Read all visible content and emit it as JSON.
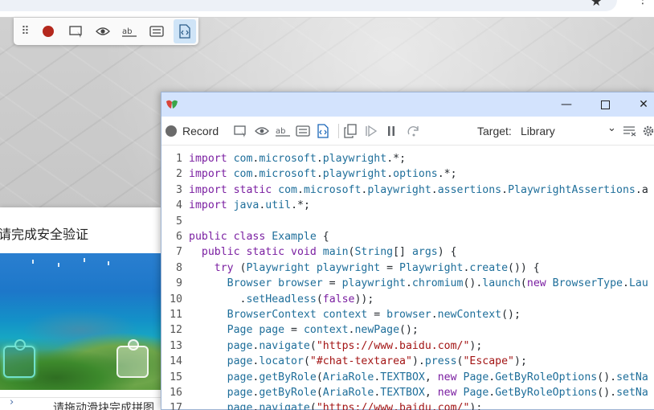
{
  "browser": {
    "star_icon": "star-icon",
    "menu_icon": "kebab-menu-icon"
  },
  "recorder_toolbar": {
    "items": [
      "drag-grip-icon",
      "record-icon",
      "pick-locator-icon",
      "assert-visibility-icon",
      "assert-text-icon",
      "assert-value-icon",
      "assert-snapshot-icon"
    ],
    "grip_glyph": "⠿",
    "active_item": "assert-snapshot-icon"
  },
  "captcha": {
    "title": "请完成安全验证",
    "hint": "请拖动滑块完成拼图",
    "slider_arrow": "›"
  },
  "inspector": {
    "window_controls": {
      "minimize": "—",
      "close": "✕"
    },
    "toolbar": {
      "record_label": "Record",
      "target_label": "Target:",
      "target_value": "Library",
      "icons": [
        "record-icon",
        "pick-locator-icon",
        "assert-visibility-icon",
        "assert-text-icon",
        "assert-value-icon",
        "assert-snapshot-icon",
        "copy-icon",
        "resume-icon",
        "pause-icon",
        "step-over-icon",
        "clear-icon",
        "settings-icon"
      ]
    },
    "code_lines": [
      {
        "n": "1",
        "tokens": [
          [
            "kw",
            "import "
          ],
          [
            "ty",
            "com"
          ],
          [
            "pl",
            "."
          ],
          [
            "ty",
            "microsoft"
          ],
          [
            "pl",
            "."
          ],
          [
            "ty",
            "playwright"
          ],
          [
            "pl",
            ".*;"
          ]
        ]
      },
      {
        "n": "2",
        "tokens": [
          [
            "kw",
            "import "
          ],
          [
            "ty",
            "com"
          ],
          [
            "pl",
            "."
          ],
          [
            "ty",
            "microsoft"
          ],
          [
            "pl",
            "."
          ],
          [
            "ty",
            "playwright"
          ],
          [
            "pl",
            "."
          ],
          [
            "ty",
            "options"
          ],
          [
            "pl",
            ".*;"
          ]
        ]
      },
      {
        "n": "3",
        "tokens": [
          [
            "kw",
            "import static "
          ],
          [
            "ty",
            "com"
          ],
          [
            "pl",
            "."
          ],
          [
            "ty",
            "microsoft"
          ],
          [
            "pl",
            "."
          ],
          [
            "ty",
            "playwright"
          ],
          [
            "pl",
            "."
          ],
          [
            "ty",
            "assertions"
          ],
          [
            "pl",
            "."
          ],
          [
            "ty",
            "PlaywrightAssertions"
          ],
          [
            "pl",
            ".a"
          ]
        ]
      },
      {
        "n": "4",
        "tokens": [
          [
            "kw",
            "import "
          ],
          [
            "ty",
            "java"
          ],
          [
            "pl",
            "."
          ],
          [
            "ty",
            "util"
          ],
          [
            "pl",
            ".*;"
          ]
        ]
      },
      {
        "n": "5",
        "tokens": []
      },
      {
        "n": "6",
        "tokens": [
          [
            "kw",
            "public class "
          ],
          [
            "ty",
            "Example"
          ],
          [
            "pl",
            " {"
          ]
        ]
      },
      {
        "n": "7",
        "tokens": [
          [
            "pl",
            "  "
          ],
          [
            "kw",
            "public static void "
          ],
          [
            "ty",
            "main"
          ],
          [
            "pl",
            "("
          ],
          [
            "ty",
            "String"
          ],
          [
            "pl",
            "[] "
          ],
          [
            "ty",
            "args"
          ],
          [
            "pl",
            ") {"
          ]
        ]
      },
      {
        "n": "8",
        "tokens": [
          [
            "pl",
            "    "
          ],
          [
            "kw",
            "try "
          ],
          [
            "pl",
            "("
          ],
          [
            "ty",
            "Playwright playwright"
          ],
          [
            "pl",
            " = "
          ],
          [
            "ty",
            "Playwright"
          ],
          [
            "pl",
            "."
          ],
          [
            "ty",
            "create"
          ],
          [
            "pl",
            "()) {"
          ]
        ]
      },
      {
        "n": "9",
        "tokens": [
          [
            "pl",
            "      "
          ],
          [
            "ty",
            "Browser browser"
          ],
          [
            "pl",
            " = "
          ],
          [
            "ty",
            "playwright"
          ],
          [
            "pl",
            "."
          ],
          [
            "ty",
            "chromium"
          ],
          [
            "pl",
            "()."
          ],
          [
            "ty",
            "launch"
          ],
          [
            "pl",
            "("
          ],
          [
            "kw",
            "new "
          ],
          [
            "ty",
            "BrowserType"
          ],
          [
            "pl",
            "."
          ],
          [
            "ty",
            "Lau"
          ]
        ]
      },
      {
        "n": "10",
        "tokens": [
          [
            "pl",
            "        ."
          ],
          [
            "ty",
            "setHeadless"
          ],
          [
            "pl",
            "("
          ],
          [
            "kw",
            "false"
          ],
          [
            "pl",
            "));"
          ]
        ]
      },
      {
        "n": "11",
        "tokens": [
          [
            "pl",
            "      "
          ],
          [
            "ty",
            "BrowserContext context"
          ],
          [
            "pl",
            " = "
          ],
          [
            "ty",
            "browser"
          ],
          [
            "pl",
            "."
          ],
          [
            "ty",
            "newContext"
          ],
          [
            "pl",
            "();"
          ]
        ]
      },
      {
        "n": "12",
        "tokens": [
          [
            "pl",
            "      "
          ],
          [
            "ty",
            "Page page"
          ],
          [
            "pl",
            " = "
          ],
          [
            "ty",
            "context"
          ],
          [
            "pl",
            "."
          ],
          [
            "ty",
            "newPage"
          ],
          [
            "pl",
            "();"
          ]
        ]
      },
      {
        "n": "13",
        "tokens": [
          [
            "pl",
            "      "
          ],
          [
            "ty",
            "page"
          ],
          [
            "pl",
            "."
          ],
          [
            "ty",
            "navigate"
          ],
          [
            "pl",
            "("
          ],
          [
            "st",
            "\"https://www.baidu.com/\""
          ],
          [
            "pl",
            ");"
          ]
        ]
      },
      {
        "n": "14",
        "tokens": [
          [
            "pl",
            "      "
          ],
          [
            "ty",
            "page"
          ],
          [
            "pl",
            "."
          ],
          [
            "ty",
            "locator"
          ],
          [
            "pl",
            "("
          ],
          [
            "st",
            "\"#chat-textarea\""
          ],
          [
            "pl",
            ")."
          ],
          [
            "ty",
            "press"
          ],
          [
            "pl",
            "("
          ],
          [
            "st",
            "\"Escape\""
          ],
          [
            "pl",
            ");"
          ]
        ]
      },
      {
        "n": "15",
        "tokens": [
          [
            "pl",
            "      "
          ],
          [
            "ty",
            "page"
          ],
          [
            "pl",
            "."
          ],
          [
            "ty",
            "getByRole"
          ],
          [
            "pl",
            "("
          ],
          [
            "ty",
            "AriaRole"
          ],
          [
            "pl",
            "."
          ],
          [
            "ty",
            "TEXTBOX"
          ],
          [
            "pl",
            ", "
          ],
          [
            "kw",
            "new "
          ],
          [
            "ty",
            "Page"
          ],
          [
            "pl",
            "."
          ],
          [
            "ty",
            "GetByRoleOptions"
          ],
          [
            "pl",
            "()."
          ],
          [
            "ty",
            "setNa"
          ]
        ]
      },
      {
        "n": "16",
        "tokens": [
          [
            "pl",
            "      "
          ],
          [
            "ty",
            "page"
          ],
          [
            "pl",
            "."
          ],
          [
            "ty",
            "getByRole"
          ],
          [
            "pl",
            "("
          ],
          [
            "ty",
            "AriaRole"
          ],
          [
            "pl",
            "."
          ],
          [
            "ty",
            "TEXTBOX"
          ],
          [
            "pl",
            ", "
          ],
          [
            "kw",
            "new "
          ],
          [
            "ty",
            "Page"
          ],
          [
            "pl",
            "."
          ],
          [
            "ty",
            "GetByRoleOptions"
          ],
          [
            "pl",
            "()."
          ],
          [
            "ty",
            "setNa"
          ]
        ]
      },
      {
        "n": "17",
        "tokens": [
          [
            "pl",
            "      "
          ],
          [
            "ty",
            "page"
          ],
          [
            "pl",
            "."
          ],
          [
            "ty",
            "navigate"
          ],
          [
            "pl",
            "("
          ],
          [
            "st",
            "\"https://www.baidu.com/\""
          ],
          [
            "pl",
            ");"
          ]
        ]
      }
    ]
  },
  "colors": {
    "keyword": "#7a1ea1",
    "identifier": "#1e6e9a",
    "string": "#a31515",
    "titlebar": "#d3e3fd",
    "record_active": "#b4281d"
  }
}
